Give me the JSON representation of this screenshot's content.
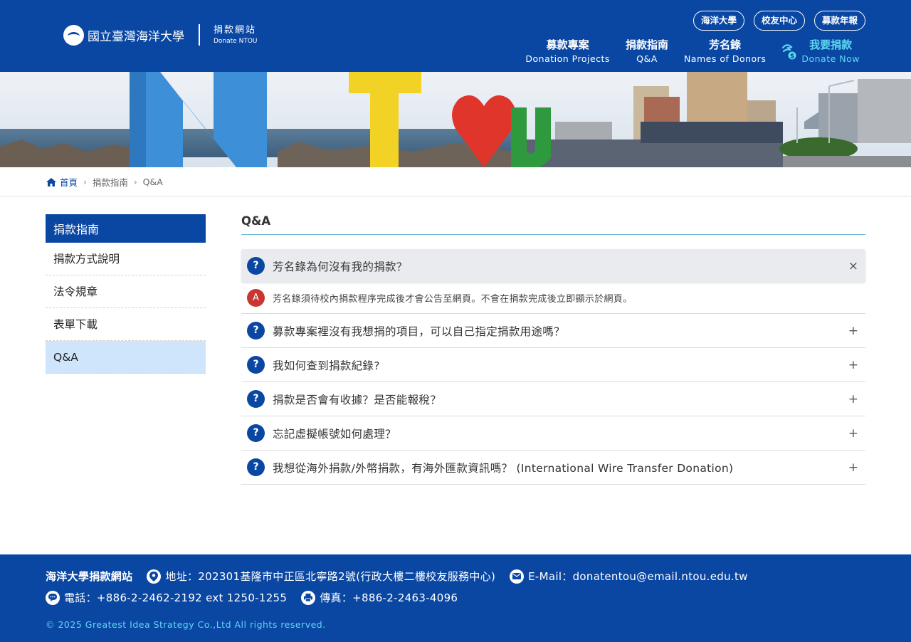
{
  "header": {
    "logo_school": "國立臺灣海洋大學",
    "logo_site_zh": "捐款網站",
    "logo_site_en": "Donate NTOU",
    "top_links": [
      "海洋大學",
      "校友中心",
      "募款年報"
    ],
    "nav": [
      {
        "zh": "募款專案",
        "en": "Donation Projects"
      },
      {
        "zh": "捐款指南",
        "en": "Q&A"
      },
      {
        "zh": "芳名錄",
        "en": "Names of Donors"
      }
    ],
    "donate": {
      "zh": "我要捐款",
      "en": "Donate Now"
    }
  },
  "breadcrumb": {
    "home": "首頁",
    "level1": "捐款指南",
    "current": "Q&A"
  },
  "sidebar": {
    "title": "捐款指南",
    "items": [
      "捐款方式說明",
      "法令規章",
      "表單下載",
      "Q&A"
    ],
    "active_index": 3
  },
  "content": {
    "title": "Q&A",
    "qa": [
      {
        "q": "芳名錄為何沒有我的捐款？",
        "a": "芳名錄須待校內捐款程序完成後才會公告至網頁。不會在捐款完成後立即顯示於網頁。",
        "open": true,
        "toggle": "×"
      },
      {
        "q": "募款專案裡沒有我想捐的項目，可以自己指定捐款用途嗎？",
        "open": false,
        "toggle": "+"
      },
      {
        "q": "我如何查到捐款紀錄?",
        "open": false,
        "toggle": "+"
      },
      {
        "q": "捐款是否會有收據？是否能報稅？",
        "open": false,
        "toggle": "+"
      },
      {
        "q": "忘記虛擬帳號如何處理？",
        "open": false,
        "toggle": "+"
      },
      {
        "q": "我想從海外捐款/外幣捐款，有海外匯款資訊嗎？ (International Wire Transfer Donation)",
        "open": false,
        "toggle": "+"
      }
    ],
    "badge_q": "?",
    "badge_a": "A"
  },
  "footer": {
    "site_name": "海洋大學捐款網站",
    "address": "地址：202301基隆市中正區北寧路2號(行政大樓二樓校友服務中心)",
    "email": "E-Mail：donatentou@email.ntou.edu.tw",
    "phone": "電話：+886-2-2462-2192 ext 1250-1255",
    "fax": "傳真：+886-2-2463-4096",
    "copyright": "© 2025 Greatest Idea Strategy Co.,Ltd All rights reserved."
  },
  "colors": {
    "primary": "#0a47a3",
    "accent": "#5ed9f2",
    "answer_badge": "#c8362f",
    "active_sidebar": "#cfe5fb"
  },
  "icons": [
    "home-icon",
    "chevron-right-icon",
    "donate-hand-icon",
    "location-icon",
    "email-icon",
    "chat-icon",
    "fax-icon",
    "close-icon",
    "plus-icon"
  ]
}
